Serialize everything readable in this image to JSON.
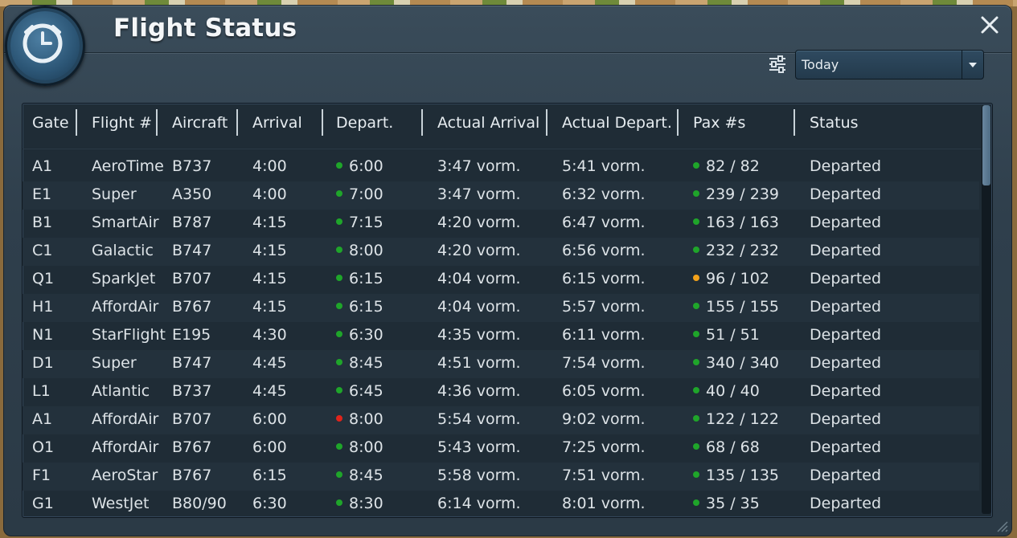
{
  "window": {
    "title": "Flight Status"
  },
  "filter": {
    "selected": "Today"
  },
  "columns": [
    "Gate",
    "Flight #",
    "Aircraft",
    "Arrival",
    "Depart.",
    "Actual Arrival",
    "Actual Depart.",
    "Pax #s",
    "Status"
  ],
  "rows": [
    {
      "gate": "A1",
      "flight": "AeroTime",
      "aircraft": "B737",
      "arrival": "4:00",
      "depart": "6:00",
      "depart_status": "green",
      "actual_arrival": "3:47 vorm.",
      "actual_depart": "5:41 vorm.",
      "pax": "82 / 82",
      "pax_status": "green",
      "status": "Departed"
    },
    {
      "gate": "E1",
      "flight": "Super",
      "aircraft": "A350",
      "arrival": "4:00",
      "depart": "7:00",
      "depart_status": "green",
      "actual_arrival": "3:47 vorm.",
      "actual_depart": "6:32 vorm.",
      "pax": "239 / 239",
      "pax_status": "green",
      "status": "Departed"
    },
    {
      "gate": "B1",
      "flight": "SmartAir",
      "aircraft": "B787",
      "arrival": "4:15",
      "depart": "7:15",
      "depart_status": "green",
      "actual_arrival": "4:20 vorm.",
      "actual_depart": "6:47 vorm.",
      "pax": "163 / 163",
      "pax_status": "green",
      "status": "Departed"
    },
    {
      "gate": "C1",
      "flight": "Galactic",
      "aircraft": "B747",
      "arrival": "4:15",
      "depart": "8:00",
      "depart_status": "green",
      "actual_arrival": "4:20 vorm.",
      "actual_depart": "6:56 vorm.",
      "pax": "232 / 232",
      "pax_status": "green",
      "status": "Departed"
    },
    {
      "gate": "Q1",
      "flight": "SparkJet",
      "aircraft": "B707",
      "arrival": "4:15",
      "depart": "6:15",
      "depart_status": "green",
      "actual_arrival": "4:04 vorm.",
      "actual_depart": "6:15 vorm.",
      "pax": "96 / 102",
      "pax_status": "orange",
      "status": "Departed"
    },
    {
      "gate": "H1",
      "flight": "AffordAir",
      "aircraft": "B767",
      "arrival": "4:15",
      "depart": "6:15",
      "depart_status": "green",
      "actual_arrival": "4:04 vorm.",
      "actual_depart": "5:57 vorm.",
      "pax": "155 / 155",
      "pax_status": "green",
      "status": "Departed"
    },
    {
      "gate": "N1",
      "flight": "StarFlight",
      "aircraft": "E195",
      "arrival": "4:30",
      "depart": "6:30",
      "depart_status": "green",
      "actual_arrival": "4:35 vorm.",
      "actual_depart": "6:11 vorm.",
      "pax": "51 / 51",
      "pax_status": "green",
      "status": "Departed"
    },
    {
      "gate": "D1",
      "flight": "Super",
      "aircraft": "B747",
      "arrival": "4:45",
      "depart": "8:45",
      "depart_status": "green",
      "actual_arrival": "4:51 vorm.",
      "actual_depart": "7:54 vorm.",
      "pax": "340 / 340",
      "pax_status": "green",
      "status": "Departed"
    },
    {
      "gate": "L1",
      "flight": "Atlantic",
      "aircraft": "B737",
      "arrival": "4:45",
      "depart": "6:45",
      "depart_status": "green",
      "actual_arrival": "4:36 vorm.",
      "actual_depart": "6:05 vorm.",
      "pax": "40 / 40",
      "pax_status": "green",
      "status": "Departed"
    },
    {
      "gate": "A1",
      "flight": "AffordAir",
      "aircraft": "B707",
      "arrival": "6:00",
      "depart": "8:00",
      "depart_status": "red",
      "actual_arrival": "5:54 vorm.",
      "actual_depart": "9:02 vorm.",
      "pax": "122 / 122",
      "pax_status": "green",
      "status": "Departed"
    },
    {
      "gate": "O1",
      "flight": "AffordAir",
      "aircraft": "B767",
      "arrival": "6:00",
      "depart": "8:00",
      "depart_status": "green",
      "actual_arrival": "5:43 vorm.",
      "actual_depart": "7:25 vorm.",
      "pax": "68 / 68",
      "pax_status": "green",
      "status": "Departed"
    },
    {
      "gate": "F1",
      "flight": "AeroStar",
      "aircraft": "B767",
      "arrival": "6:15",
      "depart": "8:45",
      "depart_status": "green",
      "actual_arrival": "5:58 vorm.",
      "actual_depart": "7:51 vorm.",
      "pax": "135 / 135",
      "pax_status": "green",
      "status": "Departed"
    },
    {
      "gate": "G1",
      "flight": "WestJet",
      "aircraft": "B80/90",
      "arrival": "6:30",
      "depart": "8:30",
      "depart_status": "green",
      "actual_arrival": "6:14 vorm.",
      "actual_depart": "8:01 vorm.",
      "pax": "35 / 35",
      "pax_status": "green",
      "status": "Departed"
    }
  ],
  "colors": {
    "green": "#1fa52a",
    "orange": "#f2a11a",
    "red": "#e0241b"
  }
}
